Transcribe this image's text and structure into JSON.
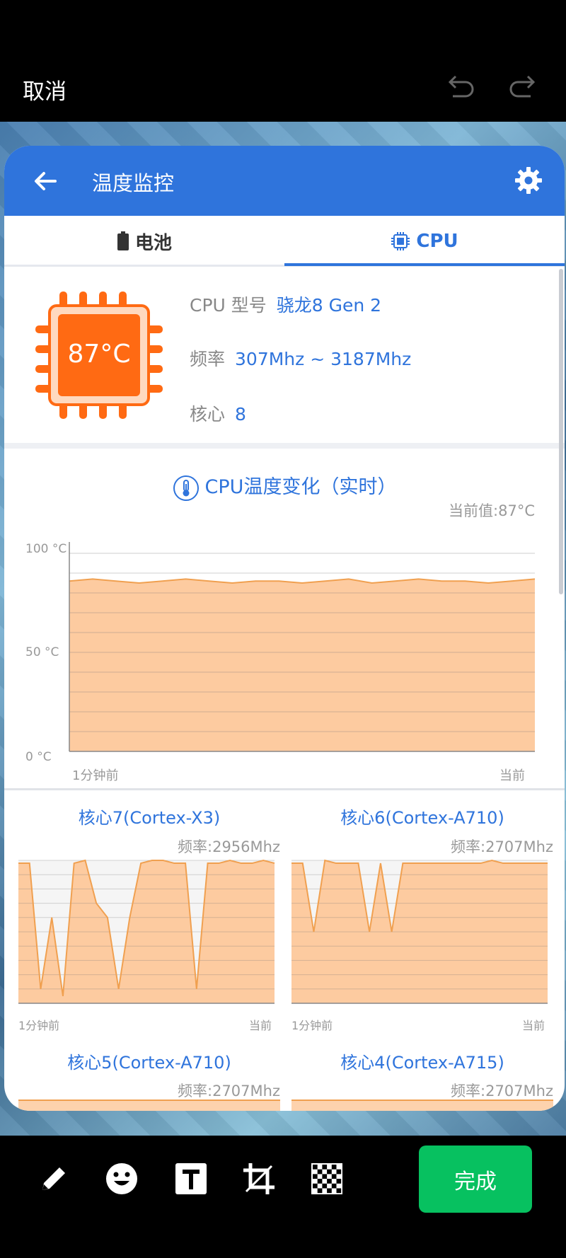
{
  "editor": {
    "cancel_label": "取消",
    "done_label": "完成",
    "tools": [
      "pencil-icon",
      "emoji-icon",
      "text-icon",
      "crop-icon",
      "mosaic-icon"
    ]
  },
  "app": {
    "title": "温度监控",
    "tabs": [
      {
        "label": "电池"
      },
      {
        "label": "CPU"
      }
    ],
    "active_tab": "CPU",
    "accent": "#2f74dc"
  },
  "cpu": {
    "temp": "87°C",
    "model_label": "CPU 型号",
    "model_value": "骁龙8 Gen 2",
    "freq_label": "频率",
    "freq_value": "307Mhz ~ 3187Mhz",
    "cores_label": "核心",
    "cores_value": "8"
  },
  "chart": {
    "title": "CPU温度变化（实时）",
    "current": "当前值:87°C",
    "y_ticks": [
      "100 °C",
      "50 °C",
      "0 °C"
    ],
    "x_start": "1分钟前",
    "x_end": "当前"
  },
  "chart_data": [
    {
      "type": "area",
      "title": "CPU温度变化（实时）",
      "ylim": [
        0,
        100
      ],
      "x": [
        "1分钟前",
        "",
        "",
        "",
        "",
        "",
        "",
        "",
        "",
        "",
        "",
        "",
        "",
        "",
        "",
        "",
        "",
        "",
        "",
        "",
        "当前"
      ],
      "values": [
        86,
        87,
        86,
        85,
        86,
        87,
        86,
        85,
        86,
        86,
        85,
        86,
        87,
        85,
        86,
        87,
        86,
        86,
        85,
        86,
        87
      ]
    },
    {
      "type": "area",
      "title": "核心7(Cortex-X3)",
      "values": [
        0.98,
        0.98,
        0.1,
        0.6,
        0.05,
        0.98,
        1,
        0.7,
        0.6,
        0.1,
        0.6,
        0.98,
        1,
        1,
        0.98,
        0.98,
        0.1,
        0.98,
        0.98,
        1,
        0.98,
        0.98,
        1,
        0.98
      ]
    },
    {
      "type": "area",
      "title": "核心6(Cortex-A710)",
      "values": [
        0.98,
        0.98,
        0.5,
        1,
        0.98,
        0.98,
        0.98,
        0.5,
        0.98,
        0.5,
        0.98,
        0.98,
        0.98,
        0.98,
        0.98,
        0.98,
        0.98,
        0.98,
        1,
        0.98,
        0.98,
        0.98,
        0.98,
        0.98
      ]
    }
  ],
  "cores": [
    {
      "title": "核心7(Cortex-X3)",
      "freq": "频率:2956Mhz",
      "x_start": "1分钟前",
      "x_end": "当前"
    },
    {
      "title": "核心6(Cortex-A710)",
      "freq": "频率:2707Mhz",
      "x_start": "1分钟前",
      "x_end": "当前"
    },
    {
      "title": "核心5(Cortex-A710)",
      "freq": "频率:2707Mhz"
    },
    {
      "title": "核心4(Cortex-A715)",
      "freq": "频率:2707Mhz"
    }
  ]
}
